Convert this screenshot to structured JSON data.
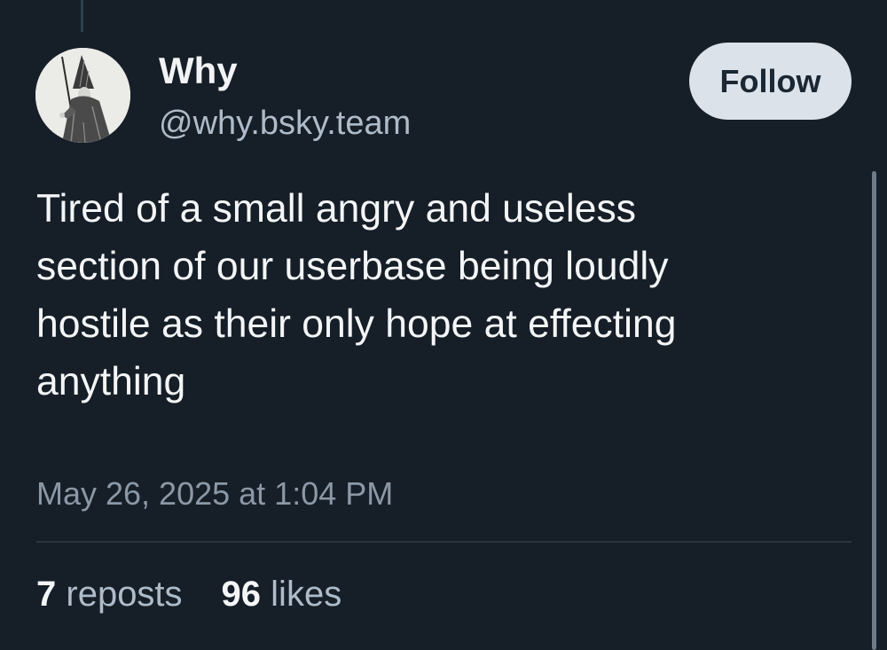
{
  "author": {
    "display_name": "Why",
    "handle": "@why.bsky.team",
    "avatar_icon": "wizard-engraving-avatar"
  },
  "actions": {
    "follow_label": "Follow"
  },
  "post": {
    "text": "Tired of a small angry and useless\nsection of our userbase being loudly\nhostile as their only hope at effecting\nanything",
    "timestamp": "May 26, 2025 at 1:04 PM"
  },
  "stats": {
    "reposts_count": "7",
    "reposts_label": "reposts",
    "likes_count": "96",
    "likes_label": "likes"
  },
  "colors": {
    "background": "#161e27",
    "follow_button_bg": "#dce2ea",
    "secondary_text": "#aebbc9"
  }
}
